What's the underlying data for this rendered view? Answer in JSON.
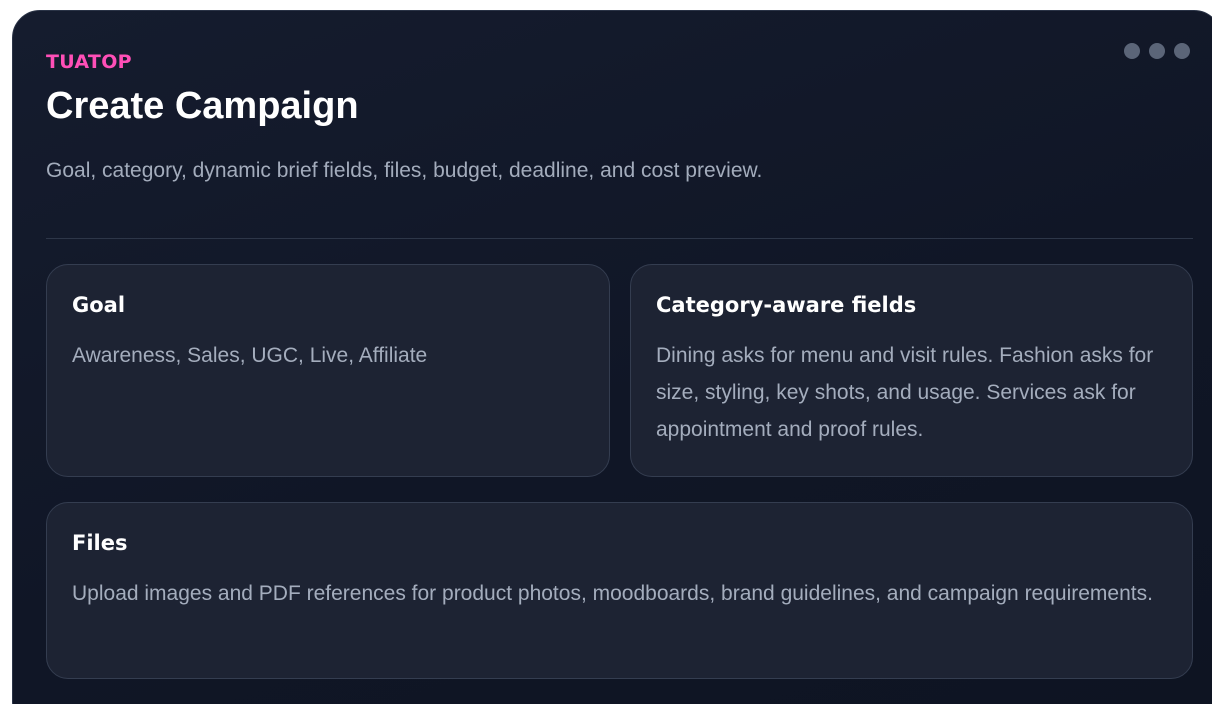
{
  "header": {
    "brand": "TUATOP",
    "title": "Create Campaign",
    "subtitle": "Goal, category, dynamic brief fields, files, budget, deadline, and cost preview."
  },
  "cards": [
    {
      "title": "Goal",
      "body": "Awareness, Sales, UGC, Live, Affiliate"
    },
    {
      "title": "Category-aware fields",
      "body": "Dining asks for menu and visit rules. Fashion asks for size, styling, key shots, and usage. Services ask for appointment and proof rules."
    },
    {
      "title": "Files",
      "body": "Upload images and PDF references for product photos, moodboards, brand guidelines, and campaign requirements."
    }
  ],
  "menu": {
    "icon": "more-dots-icon"
  },
  "colors": {
    "accent": "#ff4fb7",
    "background": "#111827",
    "card": "#1d2333",
    "text": "#ffffff",
    "muted": "#a4adbd"
  }
}
